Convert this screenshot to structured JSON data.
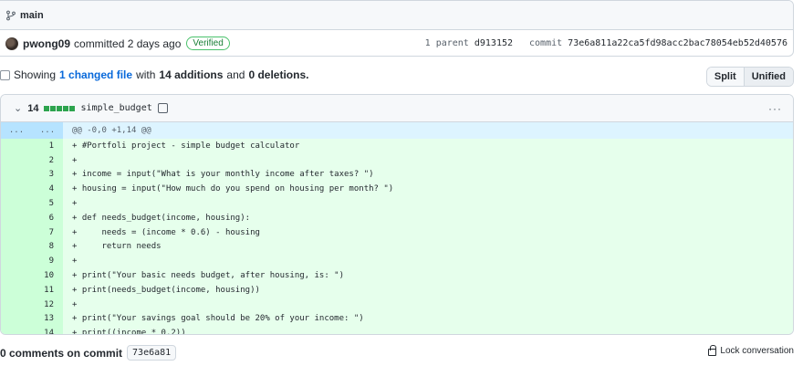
{
  "commit": {
    "branch": "main",
    "author": "pwong09",
    "committed_text": "committed 2 days ago",
    "verified_label": "Verified",
    "parent_text": "1 parent",
    "parent_sha": "d913152",
    "commit_label": "commit",
    "commit_sha": "73e6a811a22ca5fd98acc2bac78054eb52d40576"
  },
  "summary": {
    "showing": "Showing",
    "changed_files": "1 changed file",
    "with": "with",
    "additions": "14 additions",
    "and": "and",
    "deletions": "0 deletions",
    "period": "."
  },
  "view_toggle": {
    "split": "Split",
    "unified": "Unified"
  },
  "file": {
    "count": "14",
    "name": "simple_budget",
    "more": "···",
    "hunk_left": "...",
    "hunk_right": "...",
    "hunk_header": "@@ -0,0 +1,14 @@",
    "lines": [
      {
        "n": "1",
        "code": "+ #Portfoli project - simple budget calculator"
      },
      {
        "n": "2",
        "code": "+"
      },
      {
        "n": "3",
        "code": "+ income = input(\"What is your monthly income after taxes? \")"
      },
      {
        "n": "4",
        "code": "+ housing = input(\"How much do you spend on housing per month? \")"
      },
      {
        "n": "5",
        "code": "+"
      },
      {
        "n": "6",
        "code": "+ def needs_budget(income, housing):"
      },
      {
        "n": "7",
        "code": "+     needs = (income * 0.6) - housing"
      },
      {
        "n": "8",
        "code": "+     return needs"
      },
      {
        "n": "9",
        "code": "+"
      },
      {
        "n": "10",
        "code": "+ print(\"Your basic needs budget, after housing, is: \")"
      },
      {
        "n": "11",
        "code": "+ print(needs_budget(income, housing))"
      },
      {
        "n": "12",
        "code": "+"
      },
      {
        "n": "13",
        "code": "+ print(\"Your savings goal should be 20% of your income: \")"
      },
      {
        "n": "14",
        "code": "+ print((income * 0.2))"
      }
    ]
  },
  "footer": {
    "comments_text": "0 comments on commit",
    "short_sha": "73e6a81",
    "lock_label": "Lock conversation"
  },
  "colors": {
    "added_bg": "#e6ffec",
    "added_ln_bg": "#ccffd8",
    "hunk_bg": "#ddf4ff",
    "link": "#0969da",
    "verified": "#1a7f37"
  }
}
